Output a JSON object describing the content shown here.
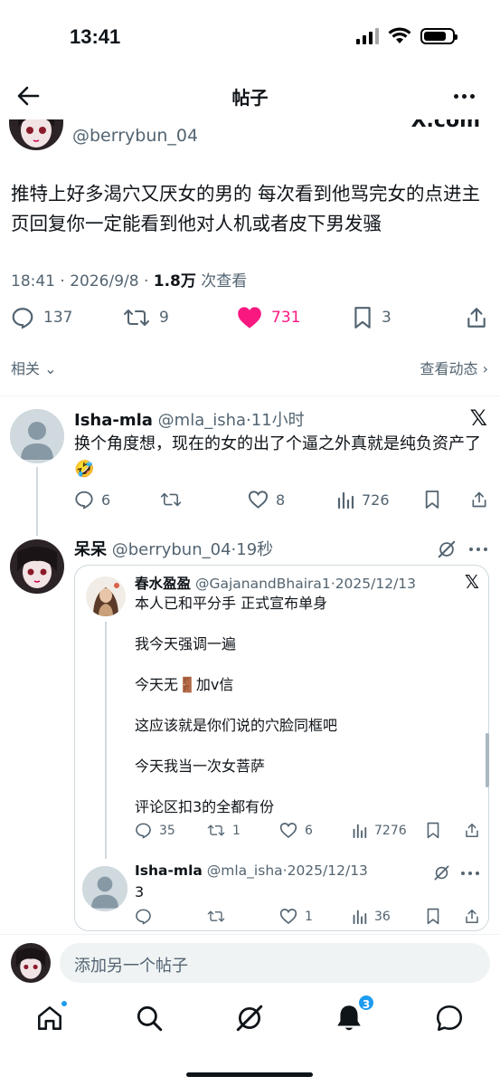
{
  "status_bar": {
    "time": "13:41"
  },
  "header": {
    "title": "帖子"
  },
  "main_post": {
    "handle": "@berrybun_04",
    "x_logo": "X.com",
    "text": "推特上好多渴穴又厌女的男的 每次看到他骂完女的点进主页回复你一定能看到他对人机或者皮下男发骚",
    "time": "18:41 · 2026/9/8 · ",
    "views_count": "1.8万",
    "views_label": " 次查看",
    "replies": "137",
    "reposts": "9",
    "likes": "731",
    "bookmarks": "3",
    "related_label": "相关",
    "activity_label": "查看动态"
  },
  "reply1": {
    "name": "Isha-mla",
    "handle": "@mla_isha",
    "time": "11小时",
    "text": "换个角度想，现在的女的出了个逼之外真就是纯负资产了🤣",
    "replies": "6",
    "reposts": "",
    "likes": "8",
    "views": "726"
  },
  "reply2": {
    "name": "呆呆",
    "handle": "@berrybun_04",
    "time": "19秒"
  },
  "quote": {
    "name": "春水盈盈",
    "handle": "@GajanandBhaira1",
    "date": "2025/12/13",
    "lines": [
      "本人已和平分手 正式宣布单身",
      "我今天强调一遍",
      "今天无🚪加v信",
      "这应该就是你们说的穴脸同框吧",
      "今天我当一次女菩萨",
      "评论区扣3的全都有份"
    ],
    "replies": "35",
    "reposts": "1",
    "likes": "6",
    "views": "7276",
    "reply": {
      "name": "Isha-mla",
      "handle": "@mla_isha",
      "date": "2025/12/13",
      "text": "3",
      "replies": "",
      "reposts": "",
      "likes": "1",
      "views": "36"
    }
  },
  "compose": {
    "placeholder": "添加另一个帖子"
  },
  "tabbar": {
    "notifications_badge": "3"
  },
  "colors": {
    "like": "#f91880",
    "accent": "#1d9bf0",
    "muted": "#536471"
  }
}
